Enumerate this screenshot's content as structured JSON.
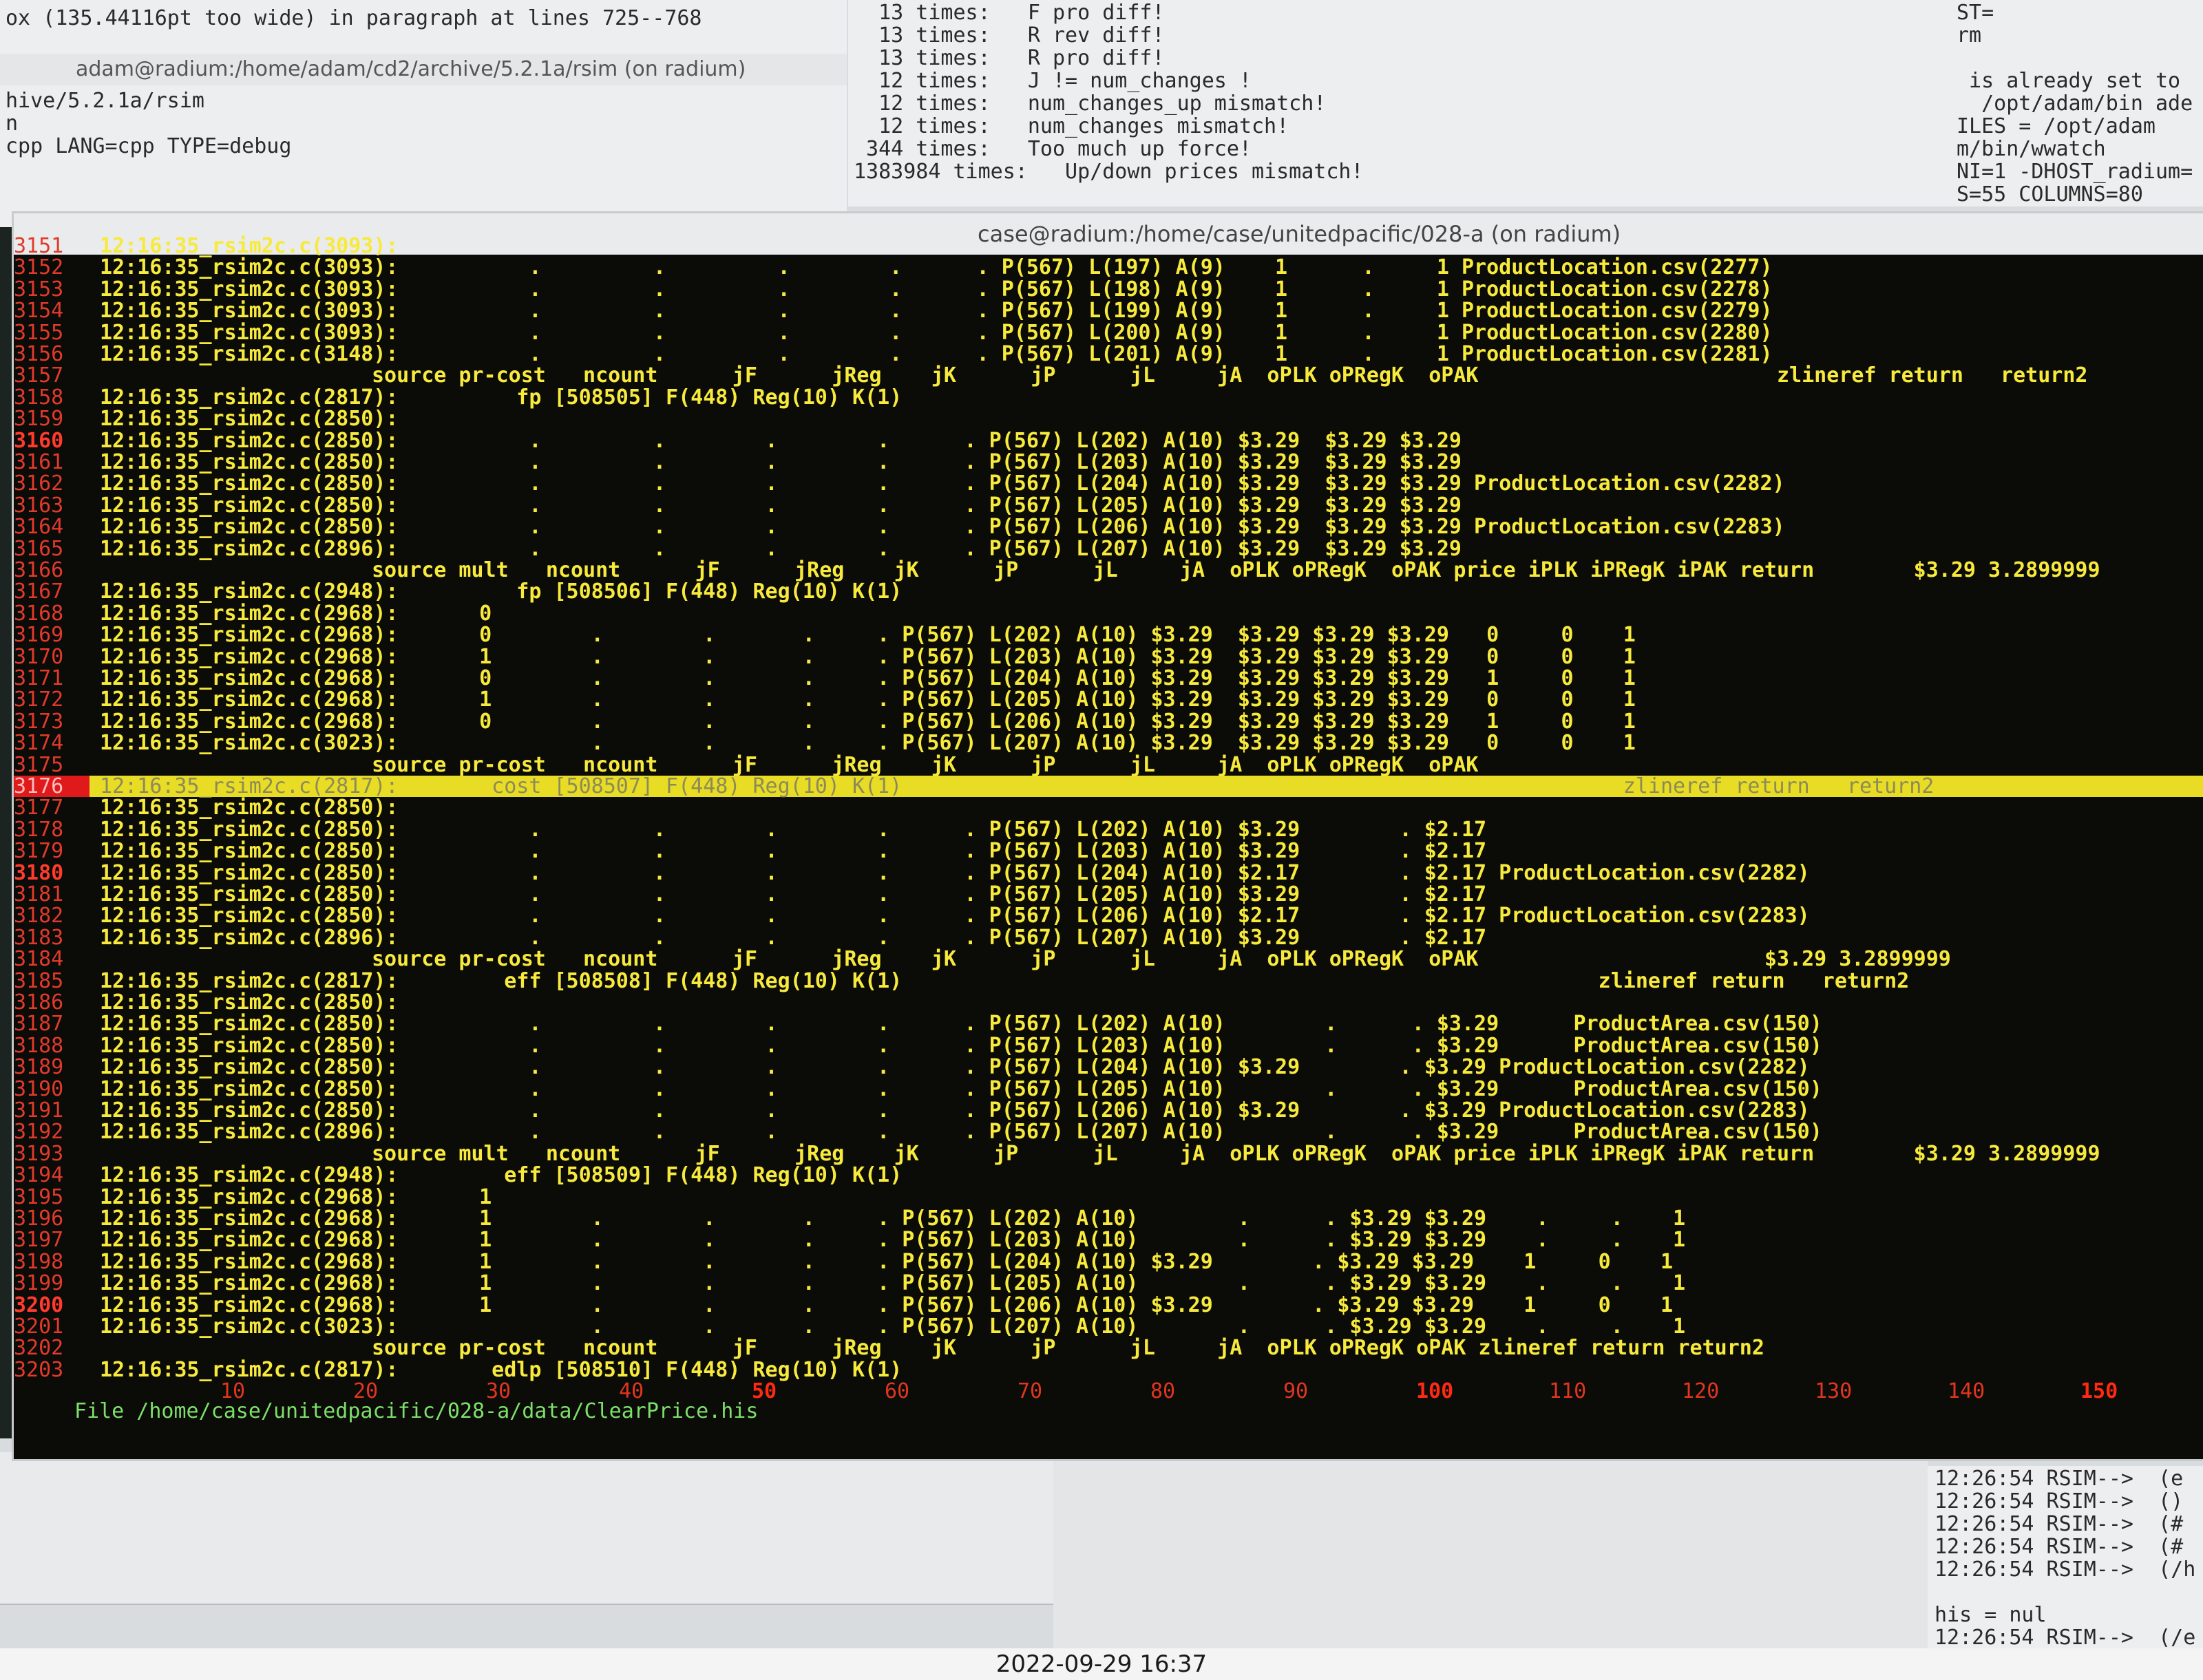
{
  "top_left_window": {
    "title": "adam@radium:/home/adam/cd2/archive/5.2.1a/rsim (on radium)",
    "first_line": "ox (135.44116pt too wide) in paragraph at lines 725--768",
    "lines": [
      "hive/5.2.1a/rsim",
      "n",
      "cpp LANG=cpp TYPE=debug"
    ]
  },
  "top_middle_window": {
    "lines": [
      "  13 times:   F pro diff!",
      "  13 times:   R rev diff!",
      "  13 times:   R pro diff!",
      "  12 times:   J != num_changes !",
      "  12 times:   num_changes_up mismatch!",
      "  12 times:   num_changes mismatch!",
      " 344 times:   Too much up force!",
      "1383984 times:   Up/down prices mismatch!"
    ]
  },
  "top_right_window": {
    "lines": [
      "ST=",
      "rm",
      "",
      " is already set to",
      "  /opt/adam/bin ade",
      "ILES = /opt/adam",
      "m/bin/wwatch",
      "NI=1 -DHOST_radium=",
      "S=55 COLUMNS=80"
    ]
  },
  "bottom_right_window": {
    "lines": [
      "12:26:54 RSIM-->  (e",
      "12:26:54 RSIM-->  ()",
      "12:26:54 RSIM-->  (#",
      "12:26:54 RSIM-->  (#",
      "12:26:54 RSIM-->  (/h",
      "",
      "his = nul",
      "12:26:54 RSIM-->  (/e"
    ]
  },
  "main_window": {
    "title": "case@radium:/home/case/unitedpacific/028-a (on radium)",
    "rows": [
      {
        "ln": "3151",
        "ts": "12:16:35_rsim2c.c(3093):",
        "body": ""
      },
      {
        "ln": "3152",
        "ts": "12:16:35_rsim2c.c(3093):",
        "body": "      .         .         .        .      . P(567) L(197) A(9)    1      .     1 ProductLocation.csv(2277)"
      },
      {
        "ln": "3153",
        "ts": "12:16:35_rsim2c.c(3093):",
        "body": "      .         .         .        .      . P(567) L(198) A(9)    1      .     1 ProductLocation.csv(2278)"
      },
      {
        "ln": "3154",
        "ts": "12:16:35_rsim2c.c(3093):",
        "body": "      .         .         .        .      . P(567) L(199) A(9)    1      .     1 ProductLocation.csv(2279)"
      },
      {
        "ln": "3155",
        "ts": "12:16:35_rsim2c.c(3093):",
        "body": "      .         .         .        .      . P(567) L(200) A(9)    1      .     1 ProductLocation.csv(2280)"
      },
      {
        "ln": "3156",
        "ts": "12:16:35_rsim2c.c(3148):",
        "body": "      .         .         .        .      . P(567) L(201) A(9)    1      .     1 ProductLocation.csv(2281)"
      },
      {
        "ln": "3157",
        "ts": "",
        "body": "",
        "header": "source pr-cost   ncount      jF      jReg    jK      jP      jL     jA  oPLK oPRegK  oPAK                        zlineref return   return2"
      },
      {
        "ln": "3158",
        "ts": "12:16:35_rsim2c.c(2817):",
        "body": "     fp [508505] F(448) Reg(10) K(1)"
      },
      {
        "ln": "3159",
        "ts": "12:16:35_rsim2c.c(2850):",
        "body": ""
      },
      {
        "ln": "3160",
        "ts": "12:16:35_rsim2c.c(2850):",
        "body": "      .         .        .        .      . P(567) L(202) A(10) $3.29  $3.29 $3.29",
        "hot": true
      },
      {
        "ln": "3161",
        "ts": "12:16:35_rsim2c.c(2850):",
        "body": "      .         .        .        .      . P(567) L(203) A(10) $3.29  $3.29 $3.29"
      },
      {
        "ln": "3162",
        "ts": "12:16:35_rsim2c.c(2850):",
        "body": "      .         .        .        .      . P(567) L(204) A(10) $3.29  $3.29 $3.29 ProductLocation.csv(2282)"
      },
      {
        "ln": "3163",
        "ts": "12:16:35_rsim2c.c(2850):",
        "body": "      .         .        .        .      . P(567) L(205) A(10) $3.29  $3.29 $3.29"
      },
      {
        "ln": "3164",
        "ts": "12:16:35_rsim2c.c(2850):",
        "body": "      .         .        .        .      . P(567) L(206) A(10) $3.29  $3.29 $3.29 ProductLocation.csv(2283)"
      },
      {
        "ln": "3165",
        "ts": "12:16:35_rsim2c.c(2896):",
        "body": "      .         .        .        .      . P(567) L(207) A(10) $3.29  $3.29 $3.29"
      },
      {
        "ln": "3166",
        "ts": "",
        "body": "",
        "header": "source mult   ncount      jF      jReg    jK      jP      jL     jA  oPLK oPRegK  oPAK price iPLK iPRegK iPAK return        $3.29 3.2899999"
      },
      {
        "ln": "3167",
        "ts": "12:16:35_rsim2c.c(2948):",
        "body": "     fp [508506] F(448) Reg(10) K(1)"
      },
      {
        "ln": "3168",
        "ts": "12:16:35_rsim2c.c(2968):",
        "body": "  0"
      },
      {
        "ln": "3169",
        "ts": "12:16:35_rsim2c.c(2968):",
        "body": "  0        .        .       .     . P(567) L(202) A(10) $3.29  $3.29 $3.29 $3.29   0     0    1"
      },
      {
        "ln": "3170",
        "ts": "12:16:35_rsim2c.c(2968):",
        "body": "  1        .        .       .     . P(567) L(203) A(10) $3.29  $3.29 $3.29 $3.29   0     0    1"
      },
      {
        "ln": "3171",
        "ts": "12:16:35_rsim2c.c(2968):",
        "body": "  0        .        .       .     . P(567) L(204) A(10) $3.29  $3.29 $3.29 $3.29   1     0    1"
      },
      {
        "ln": "3172",
        "ts": "12:16:35_rsim2c.c(2968):",
        "body": "  1        .        .       .     . P(567) L(205) A(10) $3.29  $3.29 $3.29 $3.29   0     0    1"
      },
      {
        "ln": "3173",
        "ts": "12:16:35_rsim2c.c(2968):",
        "body": "  0        .        .       .     . P(567) L(206) A(10) $3.29  $3.29 $3.29 $3.29   1     0    1"
      },
      {
        "ln": "3174",
        "ts": "12:16:35_rsim2c.c(3023):",
        "body": "           .        .       .     . P(567) L(207) A(10) $3.29  $3.29 $3.29 $3.29   0     0    1"
      },
      {
        "ln": "3175",
        "ts": "",
        "body": "",
        "header": "source pr-cost   ncount      jF      jReg    jK      jP      jL     jA  oPLK oPRegK  oPAK"
      },
      {
        "ln": "3176",
        "ts": "12:16:35_rsim2c.c(2817):",
        "body": "   cost [508507] F(448) Reg(10) K(1)                                                          zlineref return   return2",
        "selected": true
      },
      {
        "ln": "3177",
        "ts": "12:16:35_rsim2c.c(2850):",
        "body": ""
      },
      {
        "ln": "3178",
        "ts": "12:16:35_rsim2c.c(2850):",
        "body": "      .         .        .        .      . P(567) L(202) A(10) $3.29        . $2.17"
      },
      {
        "ln": "3179",
        "ts": "12:16:35_rsim2c.c(2850):",
        "body": "      .         .        .        .      . P(567) L(203) A(10) $3.29        . $2.17"
      },
      {
        "ln": "3180",
        "ts": "12:16:35_rsim2c.c(2850):",
        "body": "      .         .        .        .      . P(567) L(204) A(10) $2.17        . $2.17 ProductLocation.csv(2282)",
        "hot": true
      },
      {
        "ln": "3181",
        "ts": "12:16:35_rsim2c.c(2850):",
        "body": "      .         .        .        .      . P(567) L(205) A(10) $3.29        . $2.17"
      },
      {
        "ln": "3182",
        "ts": "12:16:35_rsim2c.c(2850):",
        "body": "      .         .        .        .      . P(567) L(206) A(10) $2.17        . $2.17 ProductLocation.csv(2283)"
      },
      {
        "ln": "3183",
        "ts": "12:16:35_rsim2c.c(2896):",
        "body": "      .         .        .        .      . P(567) L(207) A(10) $3.29        . $2.17"
      },
      {
        "ln": "3184",
        "ts": "",
        "body": "",
        "header": "source pr-cost   ncount      jF      jReg    jK      jP      jL     jA  oPLK oPRegK  oPAK                       $3.29 3.2899999"
      },
      {
        "ln": "3185",
        "ts": "12:16:35_rsim2c.c(2817):",
        "body": "    eff [508508] F(448) Reg(10) K(1)                                                        zlineref return   return2"
      },
      {
        "ln": "3186",
        "ts": "12:16:35_rsim2c.c(2850):",
        "body": ""
      },
      {
        "ln": "3187",
        "ts": "12:16:35_rsim2c.c(2850):",
        "body": "      .         .        .        .      . P(567) L(202) A(10)        .      . $3.29      ProductArea.csv(150)"
      },
      {
        "ln": "3188",
        "ts": "12:16:35_rsim2c.c(2850):",
        "body": "      .         .        .        .      . P(567) L(203) A(10)        .      . $3.29      ProductArea.csv(150)"
      },
      {
        "ln": "3189",
        "ts": "12:16:35_rsim2c.c(2850):",
        "body": "      .         .        .        .      . P(567) L(204) A(10) $3.29        . $3.29 ProductLocation.csv(2282)"
      },
      {
        "ln": "3190",
        "ts": "12:16:35_rsim2c.c(2850):",
        "body": "      .         .        .        .      . P(567) L(205) A(10)        .      . $3.29      ProductArea.csv(150)"
      },
      {
        "ln": "3191",
        "ts": "12:16:35_rsim2c.c(2850):",
        "body": "      .         .        .        .      . P(567) L(206) A(10) $3.29        . $3.29 ProductLocation.csv(2283)"
      },
      {
        "ln": "3192",
        "ts": "12:16:35_rsim2c.c(2896):",
        "body": "      .         .        .        .      . P(567) L(207) A(10)        .      . $3.29      ProductArea.csv(150)"
      },
      {
        "ln": "3193",
        "ts": "",
        "body": "",
        "header": "source mult   ncount      jF      jReg    jK      jP      jL     jA  oPLK oPRegK  oPAK price iPLK iPRegK iPAK return        $3.29 3.2899999"
      },
      {
        "ln": "3194",
        "ts": "12:16:35_rsim2c.c(2948):",
        "body": "    eff [508509] F(448) Reg(10) K(1)"
      },
      {
        "ln": "3195",
        "ts": "12:16:35_rsim2c.c(2968):",
        "body": "  1"
      },
      {
        "ln": "3196",
        "ts": "12:16:35_rsim2c.c(2968):",
        "body": "  1        .        .       .     . P(567) L(202) A(10)        .      . $3.29 $3.29    .     .    1"
      },
      {
        "ln": "3197",
        "ts": "12:16:35_rsim2c.c(2968):",
        "body": "  1        .        .       .     . P(567) L(203) A(10)        .      . $3.29 $3.29    .     .    1"
      },
      {
        "ln": "3198",
        "ts": "12:16:35_rsim2c.c(2968):",
        "body": "  1        .        .       .     . P(567) L(204) A(10) $3.29        . $3.29 $3.29    1     0    1"
      },
      {
        "ln": "3199",
        "ts": "12:16:35_rsim2c.c(2968):",
        "body": "  1        .        .       .     . P(567) L(205) A(10)        .      . $3.29 $3.29    .     .    1"
      },
      {
        "ln": "3200",
        "ts": "12:16:35_rsim2c.c(2968):",
        "body": "  1        .        .       .     . P(567) L(206) A(10) $3.29        . $3.29 $3.29    1     0    1",
        "hot": true
      },
      {
        "ln": "3201",
        "ts": "12:16:35_rsim2c.c(3023):",
        "body": "           .        .       .     . P(567) L(207) A(10)        .      . $3.29 $3.29    .     .    1"
      },
      {
        "ln": "3202",
        "ts": "",
        "body": "",
        "header": "source pr-cost   ncount      jF      jReg    jK      jP      jL     jA  oPLK oPRegK oPAK zlineref return return2"
      },
      {
        "ln": "3203",
        "ts": "12:16:35_rsim2c.c(2817):",
        "body": "   edlp [508510] F(448) Reg(10) K(1)"
      }
    ],
    "ruler": [
      "10",
      "20",
      "30",
      "40",
      "50",
      "60",
      "70",
      "80",
      "90",
      "100",
      "110",
      "120",
      "130",
      "140",
      "150"
    ],
    "status_line": "File /home/case/unitedpacific/028-a/data/ClearPrice.his"
  },
  "photo_timestamp": "2022-09-29 16:37",
  "colors": {
    "terminal_bg": "#0b0b08",
    "text_yellow": "#f7ea3c",
    "line_number_red": "#e23a2a",
    "selection_bar": "#e8dc24",
    "status_green": "#7de06a"
  }
}
